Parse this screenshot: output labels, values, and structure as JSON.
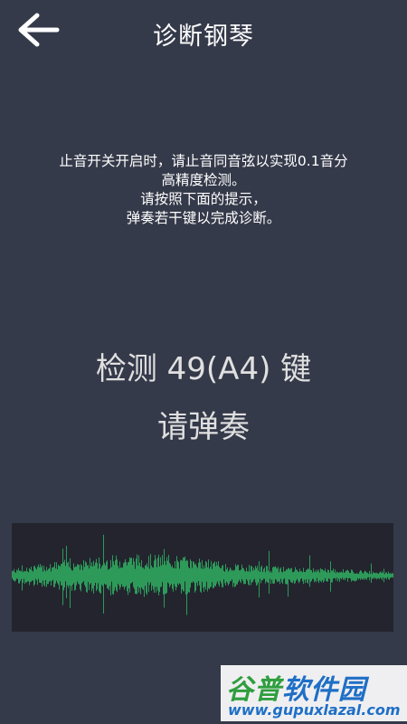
{
  "header": {
    "title": "诊断钢琴",
    "back_icon": "arrow-left-icon"
  },
  "instructions": {
    "lines": [
      "止音开关开启时，请止音同音弦以实现0.1音分",
      "高精度检测。",
      "请按照下面的提示，",
      "弹奏若干键以完成诊断。"
    ]
  },
  "prompt": {
    "detect_text": "检测 49(A4) 键",
    "play_text": "请弹奏"
  },
  "waveform": {
    "color": "#2e9a5a",
    "background": "#23242e"
  },
  "watermark": {
    "title_part1": "谷普",
    "title_part2": "软件园",
    "url": "www.gupuxlazal.com"
  },
  "colors": {
    "background": "#353a4a",
    "text": "#ffffff"
  }
}
